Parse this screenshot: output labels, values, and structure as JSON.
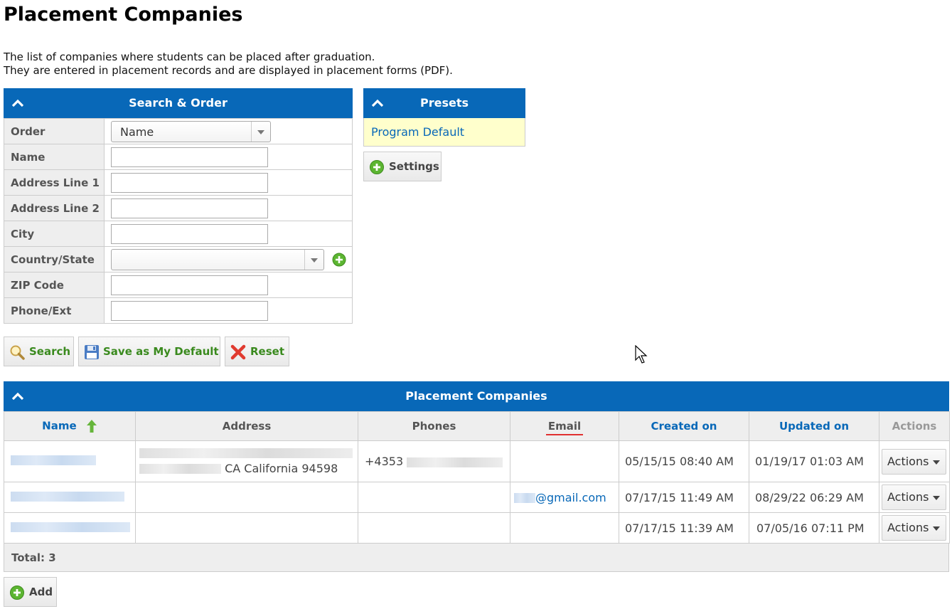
{
  "page": {
    "title": "Placement Companies",
    "description_line1": "The list of companies where students can be placed after graduation.",
    "description_line2": "They are entered in placement records and are displayed in placement forms (PDF)."
  },
  "search_panel": {
    "header": "Search & Order",
    "fields": [
      {
        "label": "Order",
        "type": "select",
        "value": "Name"
      },
      {
        "label": "Name",
        "type": "text",
        "value": ""
      },
      {
        "label": "Address Line 1",
        "type": "text",
        "value": ""
      },
      {
        "label": "Address Line 2",
        "type": "text",
        "value": ""
      },
      {
        "label": "City",
        "type": "text",
        "value": ""
      },
      {
        "label": "Country/State",
        "type": "select",
        "value": ""
      },
      {
        "label": "ZIP Code",
        "type": "text",
        "value": ""
      },
      {
        "label": "Phone/Ext",
        "type": "text",
        "value": ""
      }
    ],
    "buttons": {
      "search": "Search",
      "save_default": "Save as My Default",
      "reset": "Reset"
    }
  },
  "presets_panel": {
    "header": "Presets",
    "items": [
      "Program Default"
    ],
    "settings_label": "Settings"
  },
  "list_panel": {
    "header": "Placement Companies",
    "columns": [
      "Name",
      "Address",
      "Phones",
      "Email",
      "Created on",
      "Updated on",
      "Actions"
    ],
    "rows": [
      {
        "address_suffix": "CA California 94598",
        "phone_prefix": "+4353",
        "email": "",
        "created": "05/15/15 08:40 AM",
        "updated": "01/19/17 01:03 AM",
        "action": "Actions"
      },
      {
        "address_suffix": "",
        "phone_prefix": "",
        "email": "@gmail.com",
        "created": "07/17/15 11:49 AM",
        "updated": "08/29/22 06:29 AM",
        "action": "Actions"
      },
      {
        "address_suffix": "",
        "phone_prefix": "",
        "email": "",
        "created": "07/17/15 11:39 AM",
        "updated": "07/05/16 07:11 PM",
        "action": "Actions"
      }
    ],
    "total": "Total: 3",
    "add_label": "Add"
  },
  "colors": {
    "header_blue": "#0868b8",
    "preset_bg": "#ffffcc",
    "green_text": "#3a8a1e"
  }
}
